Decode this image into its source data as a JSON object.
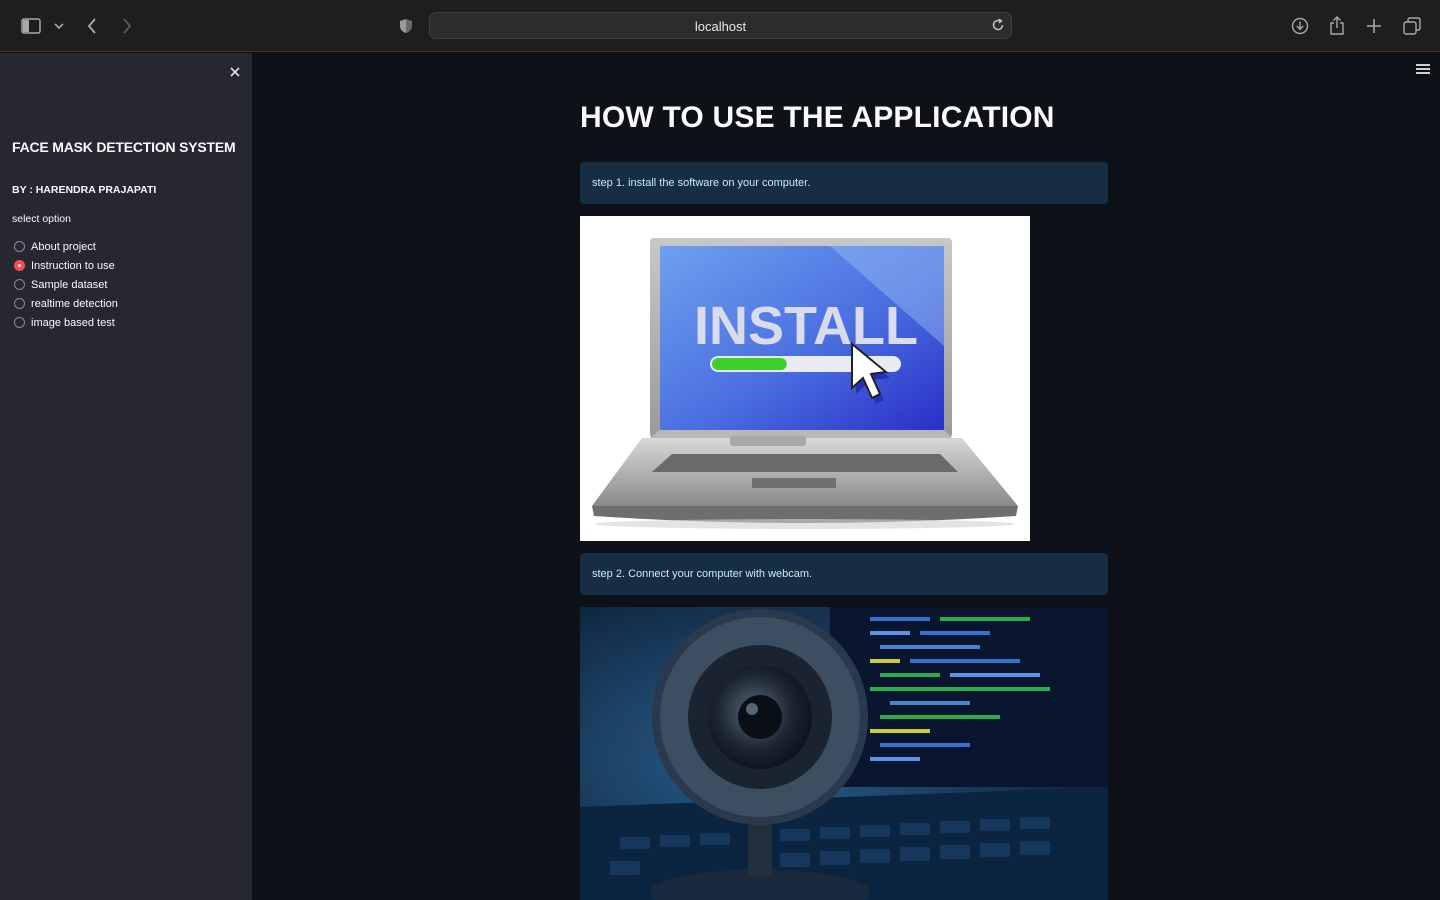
{
  "browser": {
    "url": "localhost"
  },
  "sidebar": {
    "title": "FACE MASK DETECTION SYSTEM",
    "author": "BY : HARENDRA PRAJAPATI",
    "select_label": "select option",
    "options": [
      {
        "label": "About project",
        "selected": false
      },
      {
        "label": "Instruction to use",
        "selected": true
      },
      {
        "label": "Sample dataset",
        "selected": false
      },
      {
        "label": "realtime detection",
        "selected": false
      },
      {
        "label": "image based test",
        "selected": false
      }
    ]
  },
  "main": {
    "title": "HOW TO USE THE APPLICATION",
    "steps": [
      {
        "text": "step 1. install the software on your computer.",
        "image_text": "INSTALL",
        "install_progress": 0.4
      },
      {
        "text": "step 2. Connect your computer with webcam."
      }
    ]
  },
  "colors": {
    "accent": "#ff4b4b",
    "info_bg": "#172d43",
    "info_text": "#c7ebff",
    "sidebar_bg": "#262730",
    "main_bg": "#0e1117"
  }
}
